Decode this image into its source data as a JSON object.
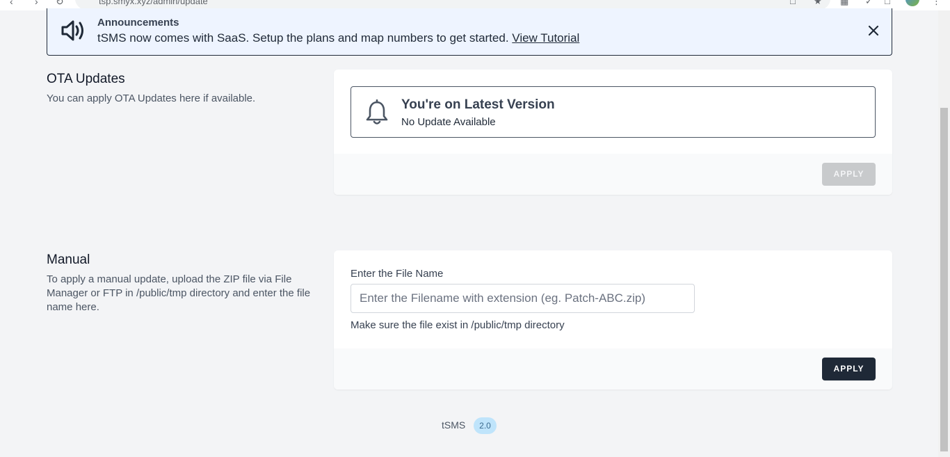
{
  "browser": {
    "url": "tsp.smyx.xyz/admin/update"
  },
  "announcement": {
    "title": "Announcements",
    "message": "tSMS now comes with SaaS. Setup the plans and map numbers to get started.",
    "link": "View Tutorial"
  },
  "ota": {
    "title": "OTA Updates",
    "description": "You can apply OTA Updates here if available.",
    "status_title": "You're on Latest Version",
    "status_subtitle": "No Update Available",
    "apply_label": "APPLY"
  },
  "manual": {
    "title": "Manual",
    "description": "To apply a manual update, upload the ZIP file via File Manager or FTP in /public/tmp directory and enter the file name here.",
    "field_label": "Enter the File Name",
    "input_value": "",
    "input_placeholder": "Enter the Filename with extension (eg. Patch-ABC.zip)",
    "help_text": "Make sure the file exist in /public/tmp directory",
    "apply_label": "APPLY"
  },
  "footer": {
    "brand": "tSMS",
    "version": "2.0"
  },
  "colors": {
    "primary": "#1f2937",
    "disabled": "#c8cacc",
    "announcement_bg": "#eef4ff",
    "badge_bg": "#bfe4fb"
  }
}
